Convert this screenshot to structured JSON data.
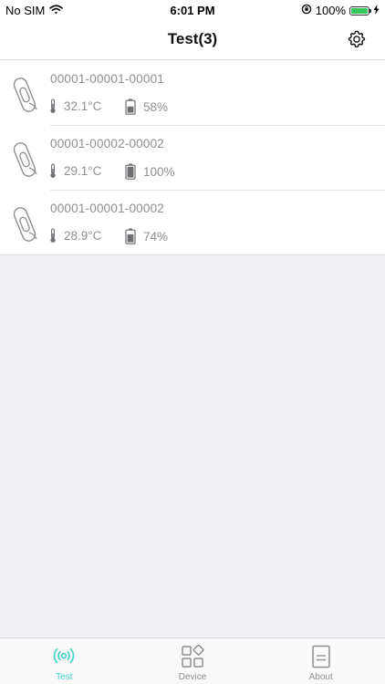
{
  "status_bar": {
    "carrier": "No SIM",
    "time": "6:01 PM",
    "battery_percent": "100%",
    "battery_level": 1.0,
    "battery_color": "#35c759"
  },
  "nav": {
    "title": "Test(3)",
    "settings_icon": "gear-icon"
  },
  "devices": [
    {
      "id": "00001-00001-00001",
      "temperature": "32.1°C",
      "battery": "58%",
      "battery_level": 0.58
    },
    {
      "id": "00001-00002-00002",
      "temperature": "29.1°C",
      "battery": "100%",
      "battery_level": 1.0
    },
    {
      "id": "00001-00001-00002",
      "temperature": "28.9°C",
      "battery": "74%",
      "battery_level": 0.74
    }
  ],
  "tabs": [
    {
      "label": "Test",
      "icon": "broadcast-icon",
      "active": true
    },
    {
      "label": "Device",
      "icon": "grid-icon",
      "active": false
    },
    {
      "label": "About",
      "icon": "document-icon",
      "active": false
    }
  ],
  "colors": {
    "accent": "#3fd0c9",
    "secondary_text": "#8e8e93",
    "background": "#efeff4"
  }
}
